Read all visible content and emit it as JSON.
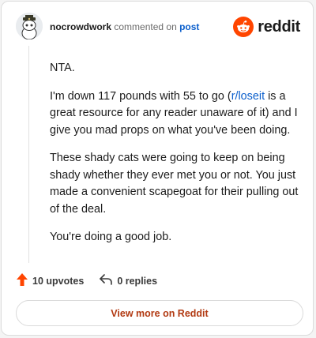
{
  "header": {
    "username": "nocrowdwork",
    "action_text": "commented on",
    "post_link": "post",
    "brand": "reddit"
  },
  "comment": {
    "p1": "NTA.",
    "p2_before": "I'm down 117 pounds with 55 to go (",
    "p2_link": "r/loseit",
    "p2_after": " is a great resource for any reader unaware of it) and I give you mad props on what you've been doing.",
    "p3": "These shady cats were going to keep on being shady whether they ever met you or not. You just made a convenient scapegoat for their pulling out of the deal.",
    "p4": "You're doing a good job."
  },
  "actions": {
    "upvotes": "10 upvotes",
    "replies": "0 replies"
  },
  "footer": {
    "view_more": "View more on Reddit"
  },
  "colors": {
    "brand_orange": "#ff4500",
    "link_blue": "#0b5fcc",
    "button_text": "#b23a12"
  },
  "icons": {
    "upvote": "upvote-arrow-icon",
    "reply": "reply-arrow-icon",
    "logo": "reddit-alien-icon"
  }
}
